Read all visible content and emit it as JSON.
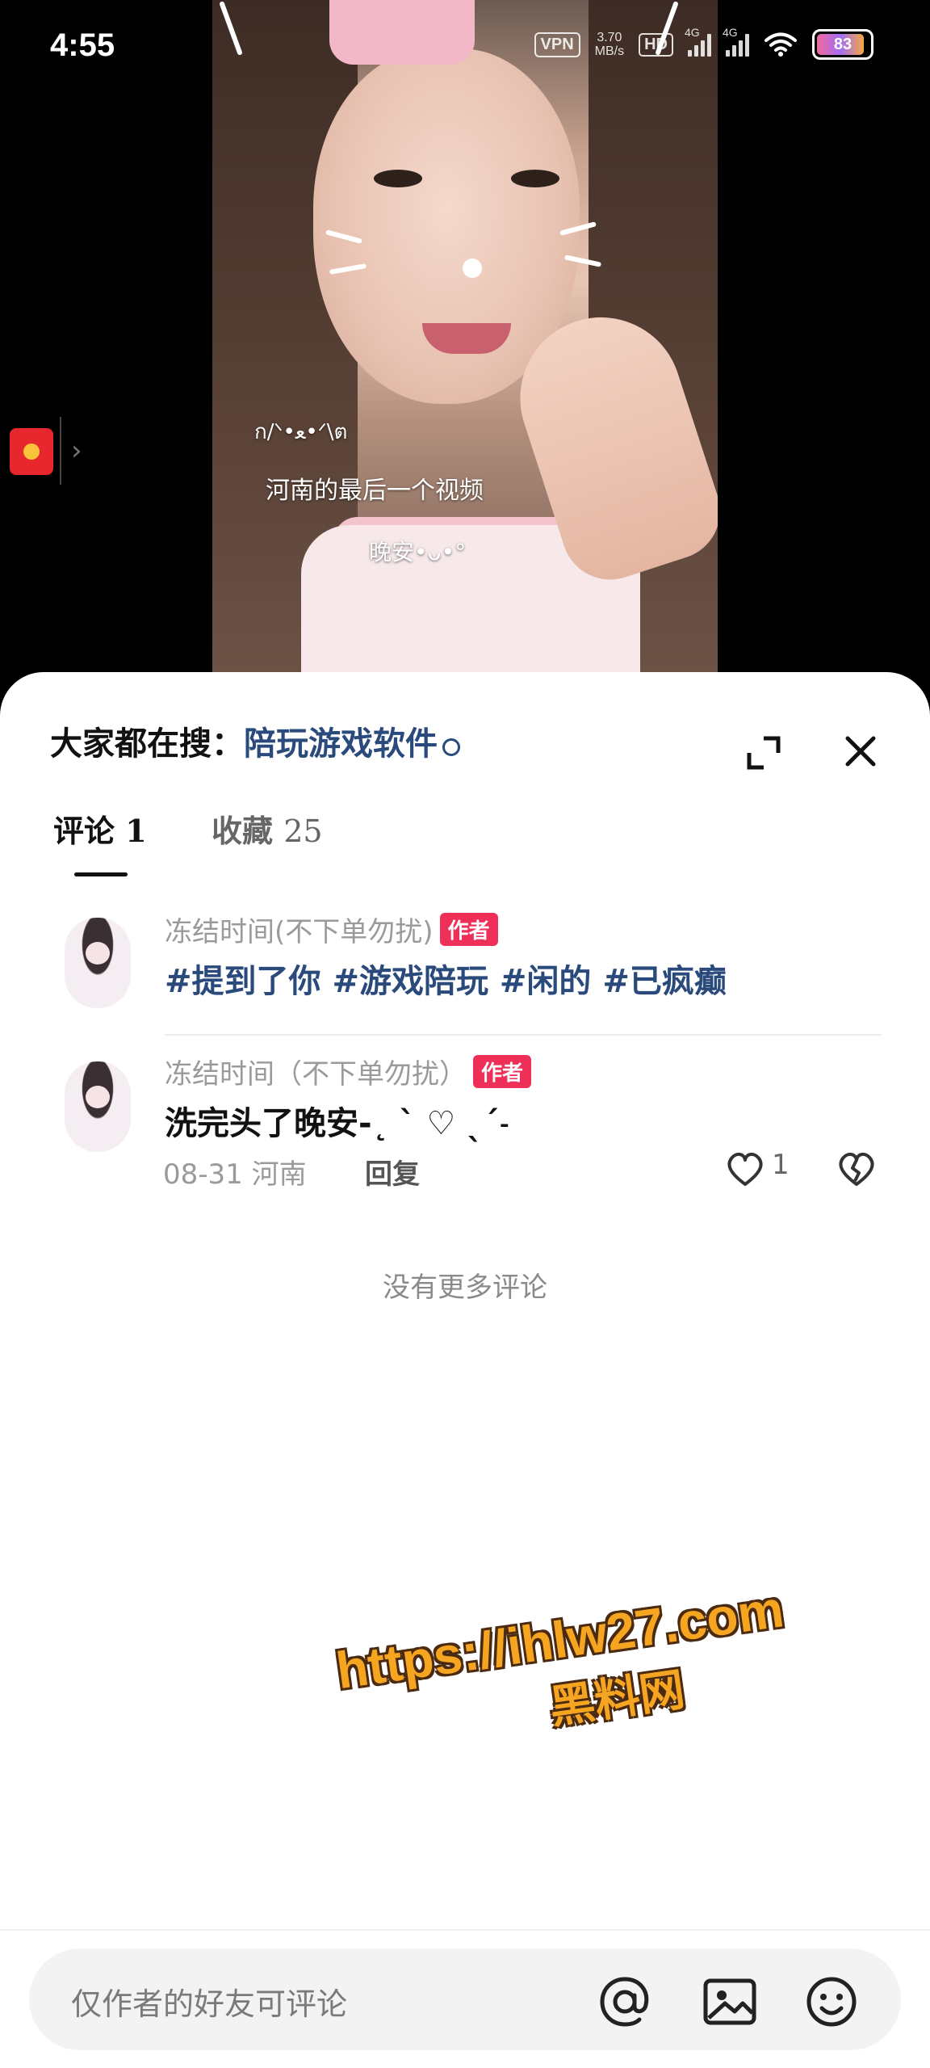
{
  "status_bar": {
    "time": "4:55",
    "vpn": "VPN",
    "net_speed_value": "3.70",
    "net_speed_unit": "MB/s",
    "hd": "HD",
    "net_type_1": "4G",
    "net_type_2": "4G",
    "battery": "83"
  },
  "video": {
    "caption_kaomoji": "ก/ᐠ•ﻌ•ᐟ\\ต",
    "caption_main": "河南的最后一个视频",
    "caption_night": "晚安•ᴗ•°"
  },
  "sheet": {
    "search_prefix": "大家都在搜：",
    "search_keyword": "陪玩游戏软件",
    "tabs": [
      {
        "label": "评论",
        "count": "1"
      },
      {
        "label": "收藏",
        "count": "25"
      }
    ]
  },
  "comments": [
    {
      "user": "冻结时间(不下单勿扰)",
      "badge": "作者",
      "text": "#提到了你 #游戏陪玩 #闲的 #已疯癫"
    },
    {
      "user": "冻结时间（不下单勿扰）",
      "badge": "作者",
      "text": "洗完头了晚安-˛ ˋ ♡ ˎˊ˗",
      "date_location": "08-31 河南",
      "reply_label": "回复",
      "likes": "1"
    }
  ],
  "no_more_text": "没有更多评论",
  "watermark": {
    "url": "https://ihlw27.com",
    "name": "黑料网"
  },
  "input": {
    "placeholder": "仅作者的好友可评论"
  },
  "icons": {
    "mention": "at-icon",
    "image": "image-icon",
    "emoji": "emoji-icon"
  },
  "colors": {
    "hashtag": "#2a4a7c",
    "author_badge": "#ee2f58",
    "watermark": "#f6a521"
  }
}
